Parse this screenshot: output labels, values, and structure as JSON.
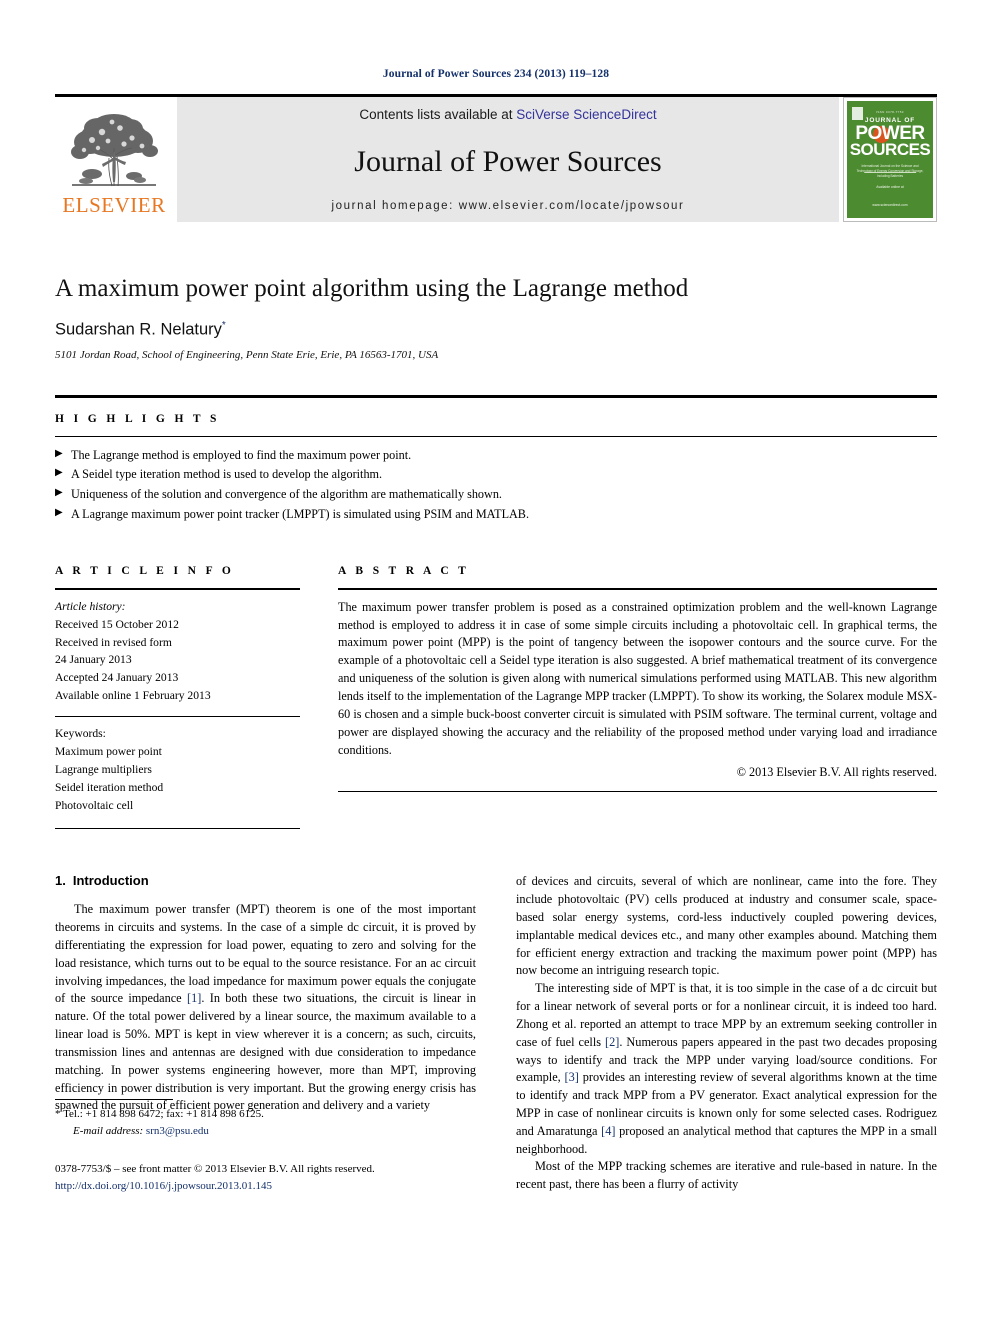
{
  "running_head": "Journal of Power Sources 234 (2013) 119–128",
  "masthead": {
    "publisher_name": "ELSEVIER",
    "contents_prefix": "Contents lists available at ",
    "contents_link": "SciVerse ScienceDirect",
    "journal_name": "Journal of Power Sources",
    "homepage": "journal homepage: www.elsevier.com/locate/jpowsour",
    "link_color": "#33339c",
    "elsevier_orange": "#E87722",
    "cover": {
      "top_line": "ISSN 0378-7753",
      "journal_of": "JOURNAL OF",
      "power": "POWER",
      "sources": "SOURCES",
      "subtitle": "International Journal on the Science and Technology of Energy Conversion and Storage, Including Batteries",
      "footer": "Available online at www.sciencedirect.com",
      "background_color": "#4d8b31"
    }
  },
  "title": "A maximum power point algorithm using the Lagrange method",
  "authors": "Sudarshan R. Nelatury",
  "author_marker": "*",
  "affiliation": "5101 Jordan Road, School of Engineering, Penn State Erie, Erie, PA 16563-1701, USA",
  "highlights": {
    "heading": "H I G H L I G H T S",
    "bullet_glyph": "▶",
    "items": [
      "The Lagrange method is employed to find the maximum power point.",
      "A Seidel type iteration method is used to develop the algorithm.",
      "Uniqueness of the solution and convergence of the algorithm are mathematically shown.",
      "A Lagrange maximum power point tracker (LMPPT) is simulated using PSIM and MATLAB."
    ]
  },
  "article_info": {
    "heading": "A R T I C L E    I N F O",
    "history_label": "Article history:",
    "history": [
      "Received 15 October 2012",
      "Received in revised form",
      "24 January 2013",
      "Accepted 24 January 2013",
      "Available online 1 February 2013"
    ],
    "keywords_label": "Keywords:",
    "keywords": [
      "Maximum power point",
      "Lagrange multipliers",
      "Seidel iteration method",
      "Photovoltaic cell"
    ]
  },
  "abstract": {
    "heading": "A B S T R A C T",
    "text": "The maximum power transfer problem is posed as a constrained optimization problem and the well-known Lagrange method is employed to address it in case of some simple circuits including a photovoltaic cell. In graphical terms, the maximum power point (MPP) is the point of tangency between the isopower contours and the source curve. For the example of a photovoltaic cell a Seidel type iteration is also suggested. A brief mathematical treatment of its convergence and uniqueness of the solution is given along with numerical simulations performed using MATLAB. This new algorithm lends itself to the implementation of the Lagrange MPP tracker (LMPPT). To show its working, the Solarex module MSX-60 is chosen and a simple buck-boost converter circuit is simulated with PSIM software. The terminal current, voltage and power are displayed showing the accuracy and the reliability of the proposed method under varying load and irradiance conditions.",
    "copyright": "© 2013 Elsevier B.V. All rights reserved."
  },
  "body": {
    "section_number": "1.",
    "section_title": "Introduction",
    "left_paragraphs": [
      "The maximum power transfer (MPT) theorem is one of the most important theorems in circuits and systems. In the case of a simple dc circuit, it is proved by differentiating the expression for load power, equating to zero and solving for the load resistance, which turns out to be equal to the source resistance. For an ac circuit involving impedances, the load impedance for maximum power equals the conjugate of the source impedance [1]. In both these two situations, the circuit is linear in nature. Of the total power delivered by a linear source, the maximum available to a linear load is 50%. MPT is kept in view wherever it is a concern; as such, circuits, transmission lines and antennas are designed with due consideration to impedance matching. In power systems engineering however, more than MPT, improving efficiency in power distribution is very important. But the growing energy crisis has spawned the pursuit of efficient power generation and delivery and a variety"
    ],
    "right_paragraphs": [
      "of devices and circuits, several of which are nonlinear, came into the fore. They include photovoltaic (PV) cells produced at industry and consumer scale, space-based solar energy systems, cord-less inductively coupled powering devices, implantable medical devices etc., and many other examples abound. Matching them for efficient energy extraction and tracking the maximum power point (MPP) has now become an intriguing research topic.",
      "The interesting side of MPT is that, it is too simple in the case of a dc circuit but for a linear network of several ports or for a nonlinear circuit, it is indeed too hard. Zhong et al. reported an attempt to trace MPP by an extremum seeking controller in case of fuel cells [2]. Numerous papers appeared in the past two decades proposing ways to identify and track the MPP under varying load/source conditions. For example, [3] provides an interesting review of several algorithms known at the time to identify and track MPP from a PV generator. Exact analytical expression for the MPP in case of nonlinear circuits is known only for some selected cases. Rodriguez and Amaratunga [4] proposed an analytical method that captures the MPP in a small neighborhood.",
      "Most of the MPP tracking schemes are iterative and rule-based in nature. In the recent past, there has been a flurry of activity"
    ],
    "citation_color": "#14306b"
  },
  "footnotes": {
    "corresponding_marker": "*",
    "contact_line": "Tel.: +1 814 898 6472; fax: +1 814 898 6125.",
    "email_label": "E-mail address:",
    "email": "srn3@psu.edu",
    "issn_line": "0378-7753/$ – see front matter © 2013 Elsevier B.V. All rights reserved.",
    "doi": "http://dx.doi.org/10.1016/j.jpowsour.2013.01.145"
  }
}
